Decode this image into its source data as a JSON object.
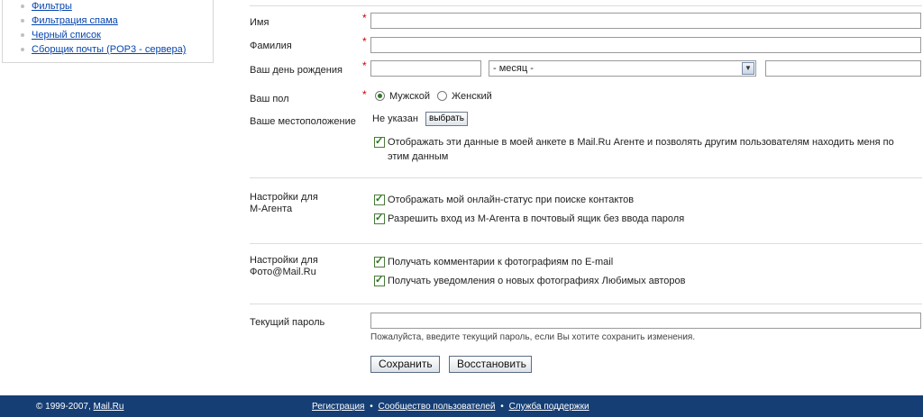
{
  "sidebar": {
    "items": [
      {
        "label": "Фильтры"
      },
      {
        "label": "Фильтрация спама"
      },
      {
        "label": "Черный список"
      },
      {
        "label": "Сборщик почты (POP3 - сервера)"
      }
    ]
  },
  "form": {
    "first_name": {
      "label": "Имя",
      "value": ""
    },
    "last_name": {
      "label": "Фамилия",
      "value": ""
    },
    "birthday": {
      "label": "Ваш день рождения",
      "day": "",
      "month": "- месяц -",
      "year": ""
    },
    "gender": {
      "label": "Ваш пол",
      "options": [
        "Мужской",
        "Женский"
      ],
      "selected": "Мужской"
    },
    "location": {
      "label": "Ваше местоположение",
      "value": "Не указан",
      "choose_label": "выбрать"
    },
    "show_in_agent": {
      "label_line1": "Отображать эти данные в моей анкете в Mail.Ru Агенте и позволять другим пользователям находить меня по",
      "label_line2": "этим данным",
      "checked": true
    },
    "required_mark": "*"
  },
  "agent_settings": {
    "label_line1": "Настройки для",
    "label_line2": "М-Агента",
    "options": [
      {
        "label": "Отображать мой онлайн-статус при поиске контактов",
        "checked": true
      },
      {
        "label": "Разрешить вход из М-Агента в почтовый ящик без ввода пароля",
        "checked": true
      }
    ]
  },
  "photo_settings": {
    "label_line1": "Настройки для",
    "label_line2": "Фото@Mail.Ru",
    "options": [
      {
        "label": "Получать комментарии к фотографиям по E-mail",
        "checked": true
      },
      {
        "label": "Получать уведомления о новых фотографиях Любимых авторов",
        "checked": true
      }
    ]
  },
  "password": {
    "label": "Текущий пароль",
    "value": "",
    "hint": "Пожалуйста, введите текущий пароль, если Вы хотите сохранить изменения."
  },
  "buttons": {
    "save": "Сохранить",
    "restore": "Восстановить"
  },
  "footer": {
    "copyright": "© 1999-2007,",
    "brand": "Mail.Ru",
    "links": [
      "Регистрация",
      "Сообщество пользователей",
      "Служба поддержки"
    ],
    "separator": "•"
  },
  "colors": {
    "footer_bg": "#153e75",
    "link": "#0645ad",
    "required": "#cc0000"
  }
}
